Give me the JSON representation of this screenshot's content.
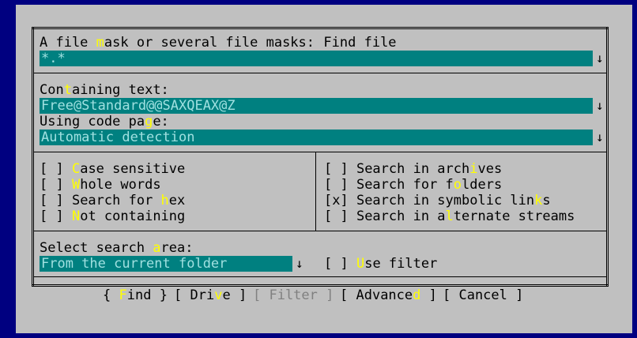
{
  "dialog": {
    "title": "Find file"
  },
  "mask": {
    "label_pre": "A file ",
    "label_hot": "m",
    "label_post": "ask or several file masks:",
    "value": "*.*",
    "arrow": "↓"
  },
  "text": {
    "label_pre": "Con",
    "label_hot": "t",
    "label_post": "aining text:",
    "value": "Free@Standard@@SAXQEAX@Z",
    "arrow": "↓"
  },
  "codepage": {
    "label_pre": "Using code pa",
    "label_hot": "g",
    "label_post": "e:",
    "value": "Automatic detection",
    "arrow": "↓"
  },
  "options_left": [
    {
      "box": "[ ] ",
      "hot": "C",
      "rest": "ase sensitive"
    },
    {
      "box": "[ ] ",
      "hot": "W",
      "rest": "hole words"
    },
    {
      "box": "[ ] ",
      "pre": "Search for ",
      "hot": "h",
      "rest": "ex"
    },
    {
      "box": "[ ] ",
      "hot": "N",
      "rest": "ot containing"
    }
  ],
  "options_right": [
    {
      "box": "[ ] ",
      "pre": "Search in arch",
      "hot": "i",
      "rest": "ves"
    },
    {
      "box": "[ ] ",
      "pre": "Search for f",
      "hot": "o",
      "rest": "lders"
    },
    {
      "box": "[x] ",
      "pre": "Search in symbolic lin",
      "hot": "k",
      "rest": "s"
    },
    {
      "box": "[ ] ",
      "pre": "Search in a",
      "hot": "l",
      "rest": "ternate streams"
    }
  ],
  "area": {
    "label_pre": "Select search ",
    "label_hot": "a",
    "label_post": "rea:",
    "value": "From the current folder",
    "arrow": "↓"
  },
  "use_filter": {
    "box": "[ ] ",
    "hot": "U",
    "rest": "se filter"
  },
  "buttons": {
    "find": {
      "open": "{ ",
      "hot": "F",
      "rest": "ind",
      "close": " }"
    },
    "drive": {
      "open": "[ ",
      "pre": "Dri",
      "hot": "v",
      "rest": "e",
      "close": " ]"
    },
    "filter": {
      "label": "[ Filter ]"
    },
    "advanced": {
      "open": "[ ",
      "pre": "Advance",
      "hot": "d",
      "close": " ]"
    },
    "cancel": {
      "label": "[ Cancel ]"
    }
  },
  "colors": {
    "background": "#000080",
    "dialog": "#c0c0c0",
    "field": "#008080",
    "hotkey": "#ffff00"
  }
}
